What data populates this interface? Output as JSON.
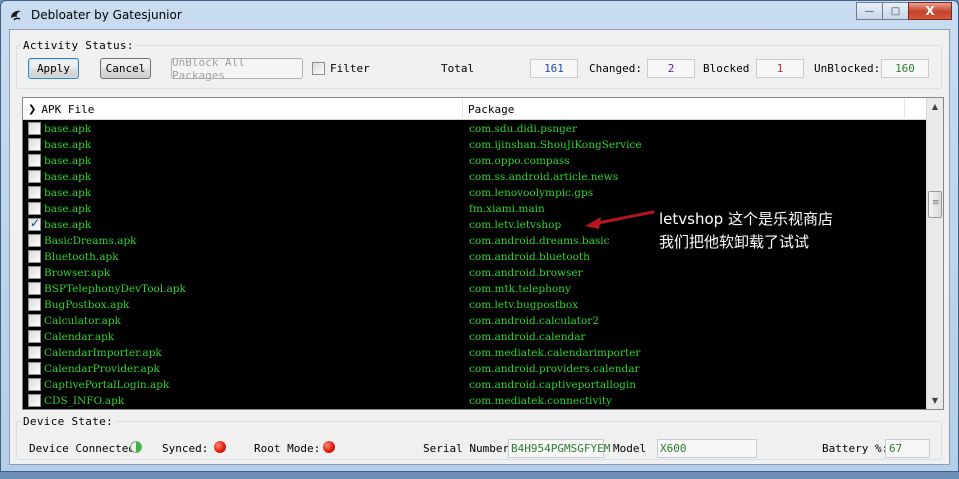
{
  "window": {
    "title": "Debloater by Gatesjunior",
    "minimize_glyph": "—",
    "maximize_glyph": "□",
    "close_glyph": "X"
  },
  "activity": {
    "legend": "Activity Status:",
    "apply_label": "Apply",
    "cancel_label": "Cancel",
    "unblock_all_label": "UnBlock All Packages",
    "filter_label": "Filter",
    "total_label": "Total",
    "total_value": "161",
    "changed_label": "Changed:",
    "changed_value": "2",
    "blocked_label": "Blocked",
    "blocked_value": "1",
    "unblocked_label": "UnBlocked:",
    "unblocked_value": "160"
  },
  "list": {
    "col_apk": "APK File",
    "col_package": "Package",
    "rows": [
      {
        "apk": "base.apk",
        "pkg": "com.sdu.didi.psnger",
        "checked": false
      },
      {
        "apk": "base.apk",
        "pkg": "com.ijinshan.ShouJiKongService",
        "checked": false
      },
      {
        "apk": "base.apk",
        "pkg": "com.oppo.compass",
        "checked": false
      },
      {
        "apk": "base.apk",
        "pkg": "com.ss.android.article.news",
        "checked": false
      },
      {
        "apk": "base.apk",
        "pkg": "com.lenovoolympic.gps",
        "checked": false
      },
      {
        "apk": "base.apk",
        "pkg": "fm.xiami.main",
        "checked": false
      },
      {
        "apk": "base.apk",
        "pkg": "com.letv.letvshop",
        "checked": true
      },
      {
        "apk": "BasicDreams.apk",
        "pkg": "com.android.dreams.basic",
        "checked": false
      },
      {
        "apk": "Bluetooth.apk",
        "pkg": "com.android.bluetooth",
        "checked": false
      },
      {
        "apk": "Browser.apk",
        "pkg": "com.android.browser",
        "checked": false
      },
      {
        "apk": "BSPTelephonyDevTool.apk",
        "pkg": "com.mtk.telephony",
        "checked": false
      },
      {
        "apk": "BugPostbox.apk",
        "pkg": "com.letv.bugpostbox",
        "checked": false
      },
      {
        "apk": "Calculator.apk",
        "pkg": "com.android.calculator2",
        "checked": false
      },
      {
        "apk": "Calendar.apk",
        "pkg": "com.android.calendar",
        "checked": false
      },
      {
        "apk": "CalendarImporter.apk",
        "pkg": "com.mediatek.calendarimporter",
        "checked": false
      },
      {
        "apk": "CalendarProvider.apk",
        "pkg": "com.android.providers.calendar",
        "checked": false
      },
      {
        "apk": "CaptivePortalLogin.apk",
        "pkg": "com.android.captiveportallogin",
        "checked": false
      },
      {
        "apk": "CDS_INFO.apk",
        "pkg": "com.mediatek.connectivity",
        "checked": false
      }
    ]
  },
  "annotation": {
    "line1": "letvshop 这个是乐视商店",
    "line2": "我们把他软卸载了试试"
  },
  "device": {
    "legend": "Device State:",
    "connected_label": "Device Connected:",
    "synced_label": "Synced:",
    "root_label": "Root Mode:",
    "serial_label": "Serial Number:",
    "serial_value": "B4H954PGMSGFYEM",
    "model_label": "Model",
    "model_value": "X600",
    "battery_label": "Battery %:",
    "battery_value": "67"
  },
  "colors": {
    "list_text": "#2fd32f",
    "list_bg": "#000000",
    "changed": "#6a1b9a",
    "blocked": "#c62828",
    "unblocked": "#2e7d32",
    "total": "#1e4fa8"
  }
}
